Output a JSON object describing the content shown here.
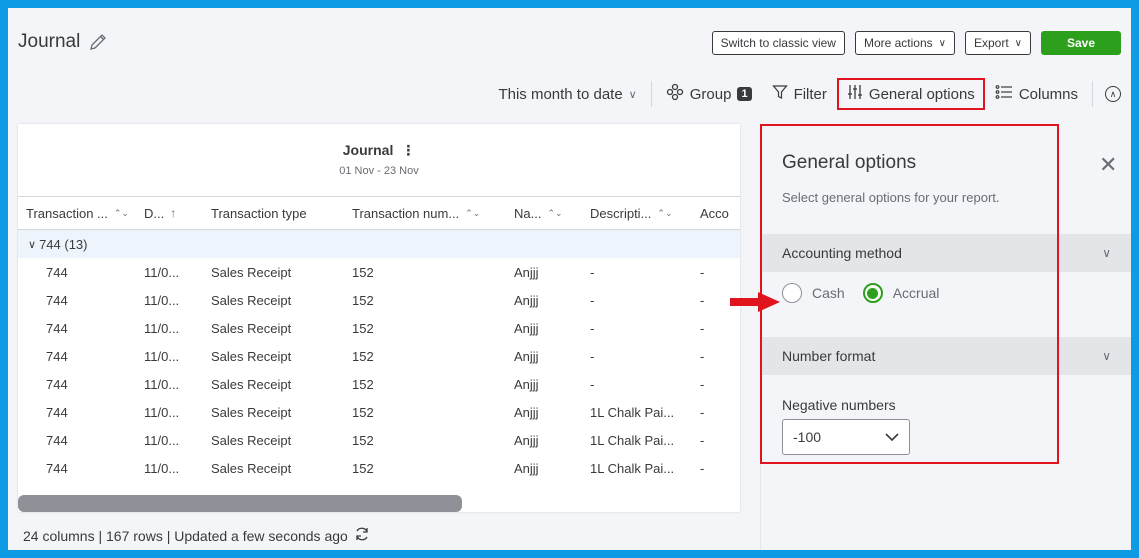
{
  "header": {
    "title": "Journal",
    "buttons": {
      "switch_classic": "Switch to classic view",
      "more_actions": "More actions",
      "export": "Export",
      "save": "Save"
    }
  },
  "toolbar": {
    "date_range": "This month to date",
    "group": "Group",
    "group_count": "1",
    "filter": "Filter",
    "general_options": "General options",
    "columns": "Columns"
  },
  "report": {
    "title": "Journal",
    "subtitle": "01 Nov - 23 Nov",
    "columns": [
      "Transaction ...",
      "D...",
      "Transaction type",
      "Transaction num...",
      "Na...",
      "Descripti...",
      "Acco"
    ],
    "group_label": "744 (13)",
    "rows": [
      [
        "744",
        "11/0...",
        "Sales Receipt",
        "152",
        "Anjjj",
        "-",
        "-"
      ],
      [
        "744",
        "11/0...",
        "Sales Receipt",
        "152",
        "Anjjj",
        "-",
        "-"
      ],
      [
        "744",
        "11/0...",
        "Sales Receipt",
        "152",
        "Anjjj",
        "-",
        "-"
      ],
      [
        "744",
        "11/0...",
        "Sales Receipt",
        "152",
        "Anjjj",
        "-",
        "-"
      ],
      [
        "744",
        "11/0...",
        "Sales Receipt",
        "152",
        "Anjjj",
        "-",
        "-"
      ],
      [
        "744",
        "11/0...",
        "Sales Receipt",
        "152",
        "Anjjj",
        "1L Chalk Pai...",
        "-"
      ],
      [
        "744",
        "11/0...",
        "Sales Receipt",
        "152",
        "Anjjj",
        "1L Chalk Pai...",
        "-"
      ],
      [
        "744",
        "11/0...",
        "Sales Receipt",
        "152",
        "Anjjj",
        "1L Chalk Pai...",
        "-"
      ]
    ]
  },
  "footer": {
    "status": "24 columns | 167 rows | Updated a few seconds ago"
  },
  "panel": {
    "title": "General options",
    "description": "Select general options for your report.",
    "accounting_method": "Accounting method",
    "cash": "Cash",
    "accrual": "Accrual",
    "selected_method": "Accrual",
    "number_format": "Number format",
    "negative_numbers_label": "Negative numbers",
    "negative_numbers_value": "-100"
  },
  "colors": {
    "accent_green": "#2ca01c",
    "highlight_red": "#e0141e",
    "frame_blue": "#0d9be6"
  }
}
